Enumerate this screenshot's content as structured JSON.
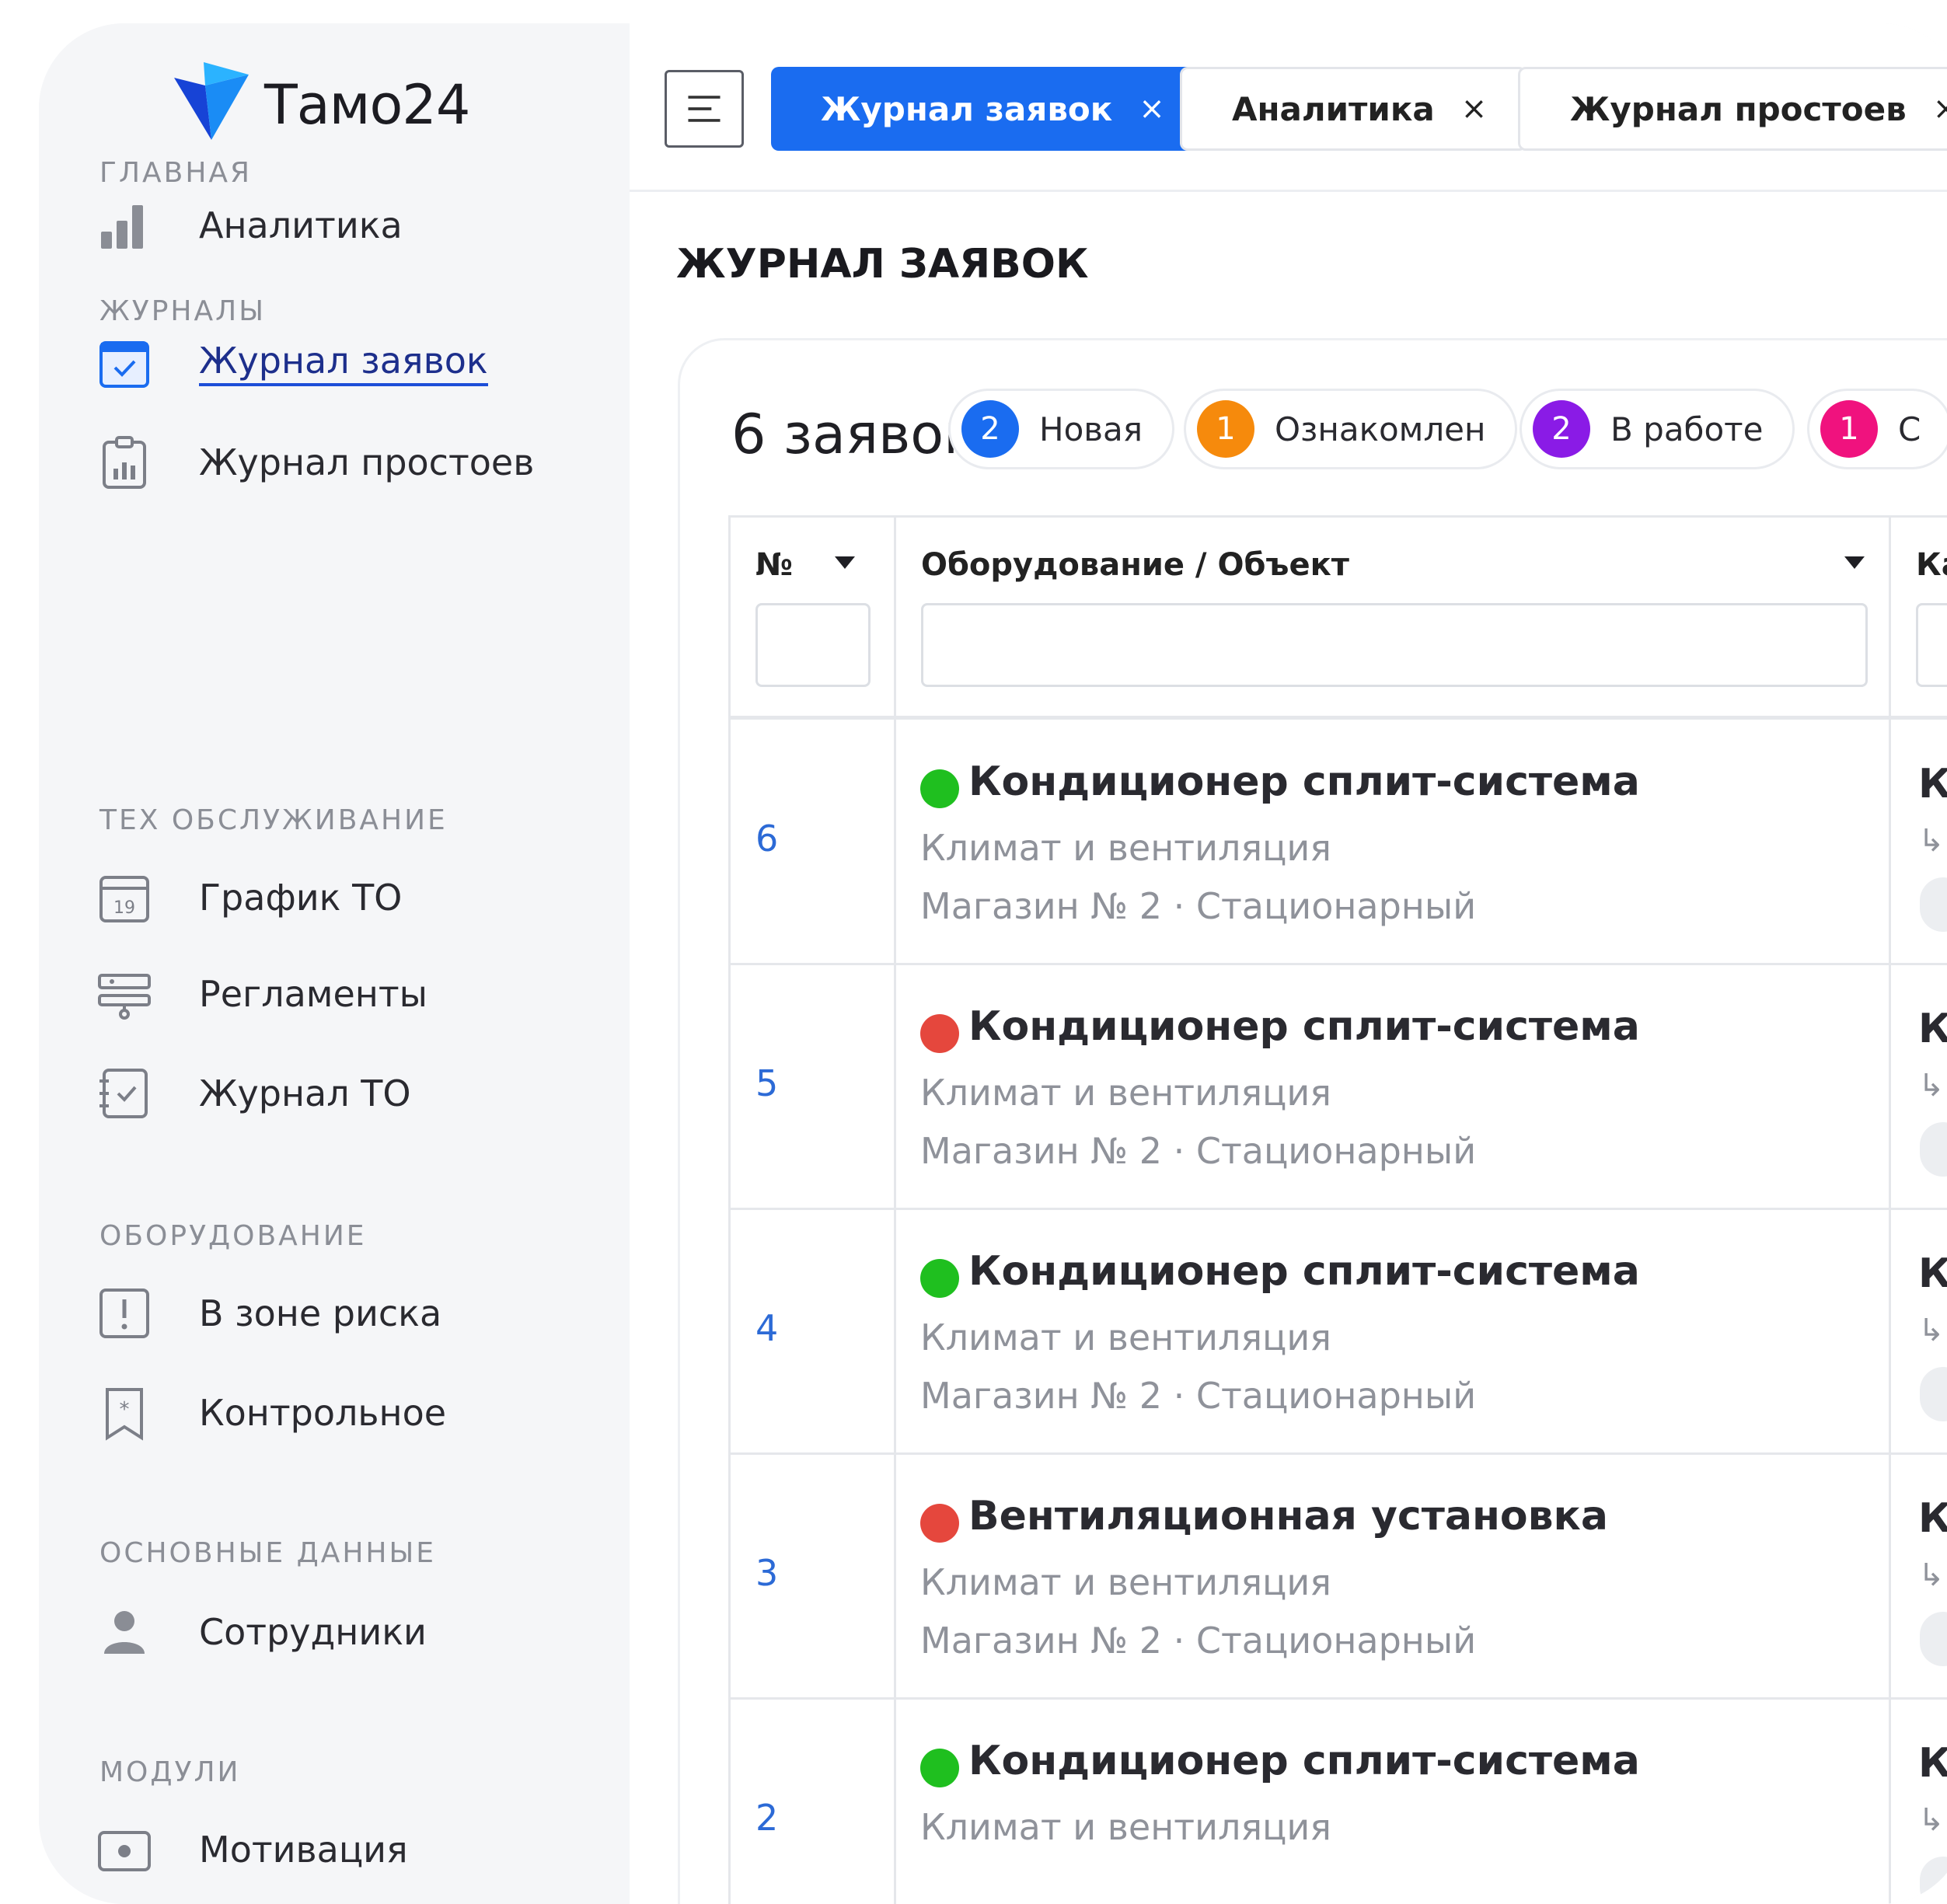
{
  "app": {
    "logo_text": "Тамо24",
    "brand_color": "#1a6cf0"
  },
  "sidebar": {
    "sections": [
      {
        "title": "ГЛАВНАЯ",
        "items": [
          {
            "label": "Аналитика",
            "icon": "bar-chart-icon"
          }
        ]
      },
      {
        "title": "ЖУРНАЛЫ",
        "items": [
          {
            "label": "Журнал заявок",
            "icon": "calendar-check-icon",
            "active": true
          },
          {
            "label": "Журнал простоев",
            "icon": "clipboard-chart-icon"
          }
        ]
      },
      {
        "title": "ТЕХ ОБСЛУЖИВАНИЕ",
        "items": [
          {
            "label": "График ТО",
            "icon": "calendar-icon",
            "icon_text": "19"
          },
          {
            "label": "Регламенты",
            "icon": "sliders-icon"
          },
          {
            "label": "Журнал ТО",
            "icon": "notebook-check-icon"
          }
        ]
      },
      {
        "title": "ОБОРУДОВАНИЕ",
        "items": [
          {
            "label": "В зоне риска",
            "icon": "alert-square-icon"
          },
          {
            "label": "Контрольное",
            "icon": "bookmark-star-icon"
          }
        ]
      },
      {
        "title": "ОСНОВНЫЕ ДАННЫЕ",
        "items": [
          {
            "label": "Сотрудники",
            "icon": "user-icon"
          }
        ]
      },
      {
        "title": "МОДУЛИ",
        "items": [
          {
            "label": "Мотивация",
            "icon": "id-card-icon"
          }
        ]
      }
    ]
  },
  "tabs": [
    {
      "label": "Журнал заявок",
      "close": "×",
      "active": true
    },
    {
      "label": "Аналитика",
      "close": "×"
    },
    {
      "label": "Журнал простоев",
      "close": "×"
    }
  ],
  "page": {
    "title": "ЖУРНАЛ ЗАЯВОК"
  },
  "summary": {
    "count_label": "6 заявок:",
    "statuses": [
      {
        "count": "2",
        "label": "Новая",
        "color": "#1a6cf0"
      },
      {
        "count": "1",
        "label": "Ознакомлен",
        "color": "#f68a0c"
      },
      {
        "count": "2",
        "label": "В работе",
        "color": "#8a1be6"
      },
      {
        "count": "1",
        "label": "С",
        "color": "#f0127e"
      }
    ]
  },
  "table": {
    "columns": {
      "num": "№",
      "equipment": "Оборудование / Объект",
      "third": "Ка"
    },
    "rows": [
      {
        "num": "6",
        "status_color": "#1fbf1f",
        "title": "Кондиционер сплит-система",
        "category": "Климат и вентиляция",
        "location": "Магазин № 2 · Стационарный",
        "third": "К",
        "arrow": "↳"
      },
      {
        "num": "5",
        "status_color": "#e5473d",
        "title": "Кондиционер сплит-система",
        "category": "Климат и вентиляция",
        "location": "Магазин № 2 · Стационарный",
        "third": "К",
        "arrow": "↳"
      },
      {
        "num": "4",
        "status_color": "#1fbf1f",
        "title": "Кондиционер сплит-система",
        "category": "Климат и вентиляция",
        "location": "Магазин № 2 · Стационарный",
        "third": "К",
        "arrow": "↳"
      },
      {
        "num": "3",
        "status_color": "#e5473d",
        "title": "Вентиляционная установка",
        "category": "Климат и вентиляция",
        "location": "Магазин № 2 · Стационарный",
        "third": "К",
        "arrow": "↳"
      },
      {
        "num": "2",
        "status_color": "#1fbf1f",
        "title": "Кондиционер сплит-система",
        "category": "Климат и вентиляция",
        "location": "",
        "third": "К",
        "arrow": "↳"
      }
    ]
  }
}
